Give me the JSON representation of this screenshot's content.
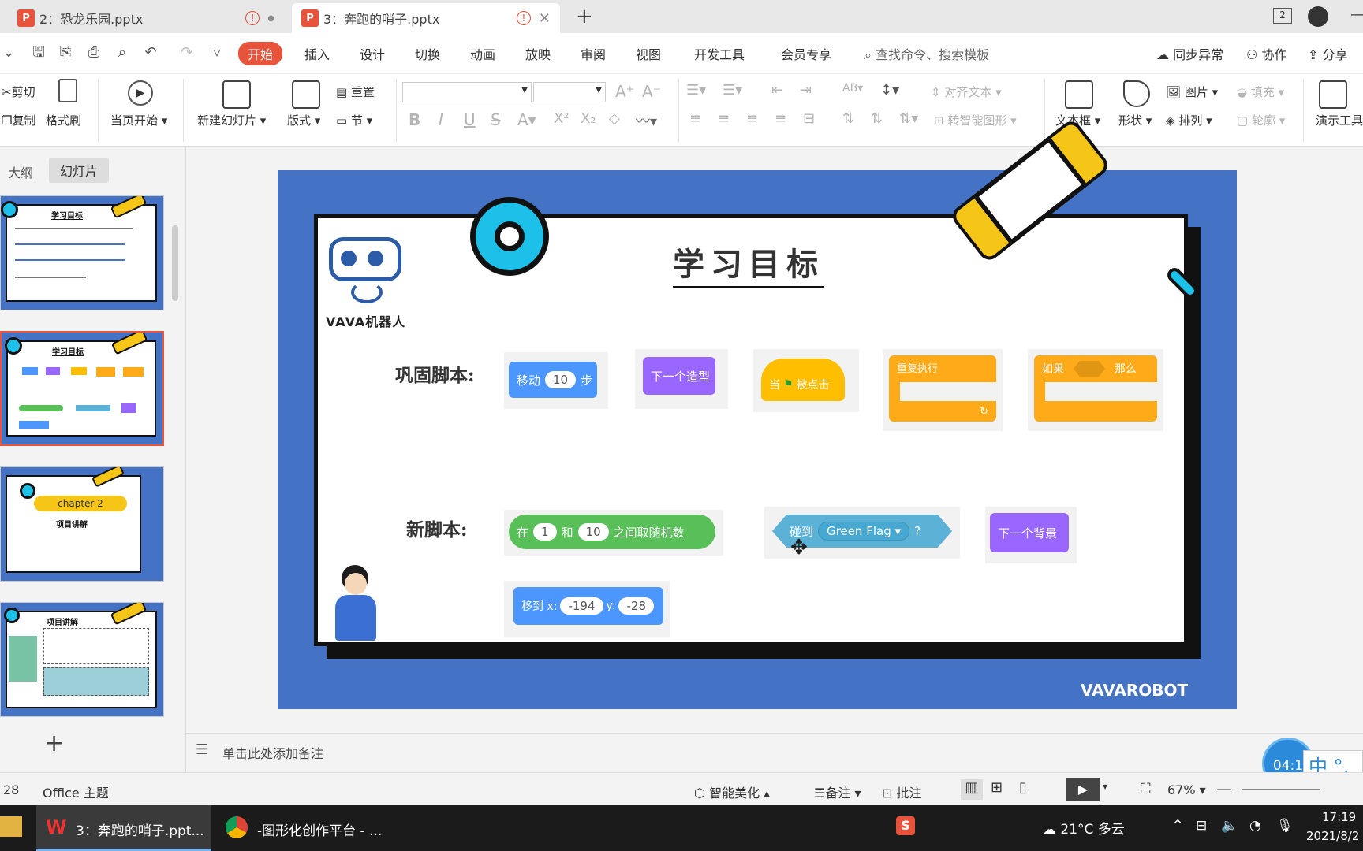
{
  "tabs": [
    {
      "label": "2：恐龙乐园.pptx"
    },
    {
      "label": "3：奔跑的哨子.pptx"
    }
  ],
  "tab_badge": "2",
  "menu": {
    "items": [
      "开始",
      "插入",
      "设计",
      "切换",
      "动画",
      "放映",
      "审阅",
      "视图",
      "开发工具",
      "会员专享"
    ],
    "search_placeholder": "查找命令、搜索模板",
    "sync": "同步异常",
    "collab": "协作",
    "share": "分享"
  },
  "ribbon": {
    "cut": "剪切",
    "copy": "复制",
    "format_painter": "格式刷",
    "from_current": "当页开始",
    "new_slide": "新建幻灯片",
    "layout": "版式",
    "reset": "重置",
    "section": "节",
    "align_text": "对齐文本",
    "smart_shape": "转智能图形",
    "textbox": "文本框",
    "shape": "形状",
    "picture": "图片",
    "fill": "填充",
    "arrange": "排列",
    "outline": "轮廓",
    "presenter": "演示工具"
  },
  "leftpane": {
    "tab_outline": "大纲",
    "tab_slides": "幻灯片",
    "thumb1_title": "学习目标",
    "thumb2_title": "学习目标",
    "thumb3_chapter": "chapter 2",
    "thumb3_sub": "项目讲解",
    "thumb4_title": "项目讲解",
    "add": "+"
  },
  "slide": {
    "title": "学习目标",
    "logo_text": "VAVA机器人",
    "label_consolidate": "巩固脚本:",
    "label_new": "新脚本:",
    "footer": "VAVAROBOT",
    "blocks": {
      "move_prefix": "移动",
      "move_value": "10",
      "move_suffix": "步",
      "next_costume": "下一个造型",
      "when_prefix": "当",
      "when_suffix": "被点击",
      "repeat": "重复执行",
      "if_prefix": "如果",
      "if_suffix": "那么",
      "random_prefix": "在",
      "random_a": "1",
      "random_mid": "和",
      "random_b": "10",
      "random_suffix": "之间取随机数",
      "touch_prefix": "碰到",
      "touch_value": "Green Flag",
      "touch_suffix": "?",
      "next_backdrop": "下一个背景",
      "goto_prefix": "移到 x:",
      "goto_x": "-194",
      "goto_ylabel": "y:",
      "goto_y": "-28"
    }
  },
  "notes_placeholder": "单击此处添加备注",
  "status": {
    "page": "28",
    "theme": "Office 主题",
    "beautify": "智能美化",
    "notes": "备注",
    "comment": "批注",
    "zoom": "67%",
    "timer": "04:1",
    "ime": "中"
  },
  "taskbar": {
    "app1": "3：奔跑的哨子.ppt...",
    "app2": "-图形化创作平台 - ...",
    "weather": "21°C 多云",
    "time": "17:19",
    "date": "2021/8/2"
  },
  "colors": {
    "accent": "#e8533b",
    "slide_blue": "#4472c4",
    "motion": "#4c97ff",
    "looks": "#9966ff",
    "events": "#ffbf00",
    "control": "#ffab19",
    "operators": "#59c059",
    "sensing": "#5cb1d6"
  }
}
